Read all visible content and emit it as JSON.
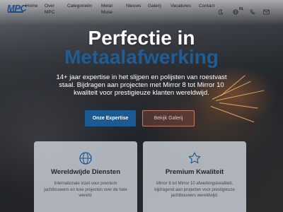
{
  "header": {
    "logo": "MPC",
    "nav": [
      {
        "label": "Home"
      },
      {
        "label": "Over\nMPC"
      },
      {
        "label": "Categorieën"
      },
      {
        "label": "Metal\nMuse"
      },
      {
        "label": "Nieuws"
      },
      {
        "label": "Galerij"
      },
      {
        "label": "Vacatures"
      },
      {
        "label": "Contact"
      }
    ],
    "language": "NL",
    "icons": [
      "moon-icon",
      "globe-icon",
      "phone-icon",
      "mail-icon"
    ]
  },
  "hero": {
    "title": "Perfectie in",
    "title_accent": "Metaalafwerking",
    "subtitle": "14+ jaar expertise in het slijpen en polijsten van roestvast staal. Bijdragen aan projecten met Mirror 8 tot Mirror 10 kwaliteit voor prestigieuze klanten wereldwijd.",
    "primary_button": "Onze Expertise",
    "secondary_button": "Bekijk Galerij"
  },
  "cards": [
    {
      "icon": "globe-icon",
      "title": "Wereldwijde Diensten",
      "text": "Internationale inzet voor premium jachtbouwers en luxe projecten over de hele wereld."
    },
    {
      "icon": "star-icon",
      "title": "Premium Kwaliteit",
      "text": "Mirror 8 tot Mirror 10 afwerkingskwaliteit, bijdragend aan projecten voor prestigieuze jachtbouwers wereldwijd."
    }
  ],
  "colors": {
    "brand": "#1e5d95",
    "button_primary": "#1b5a92",
    "hero_text": "#ffffff"
  }
}
